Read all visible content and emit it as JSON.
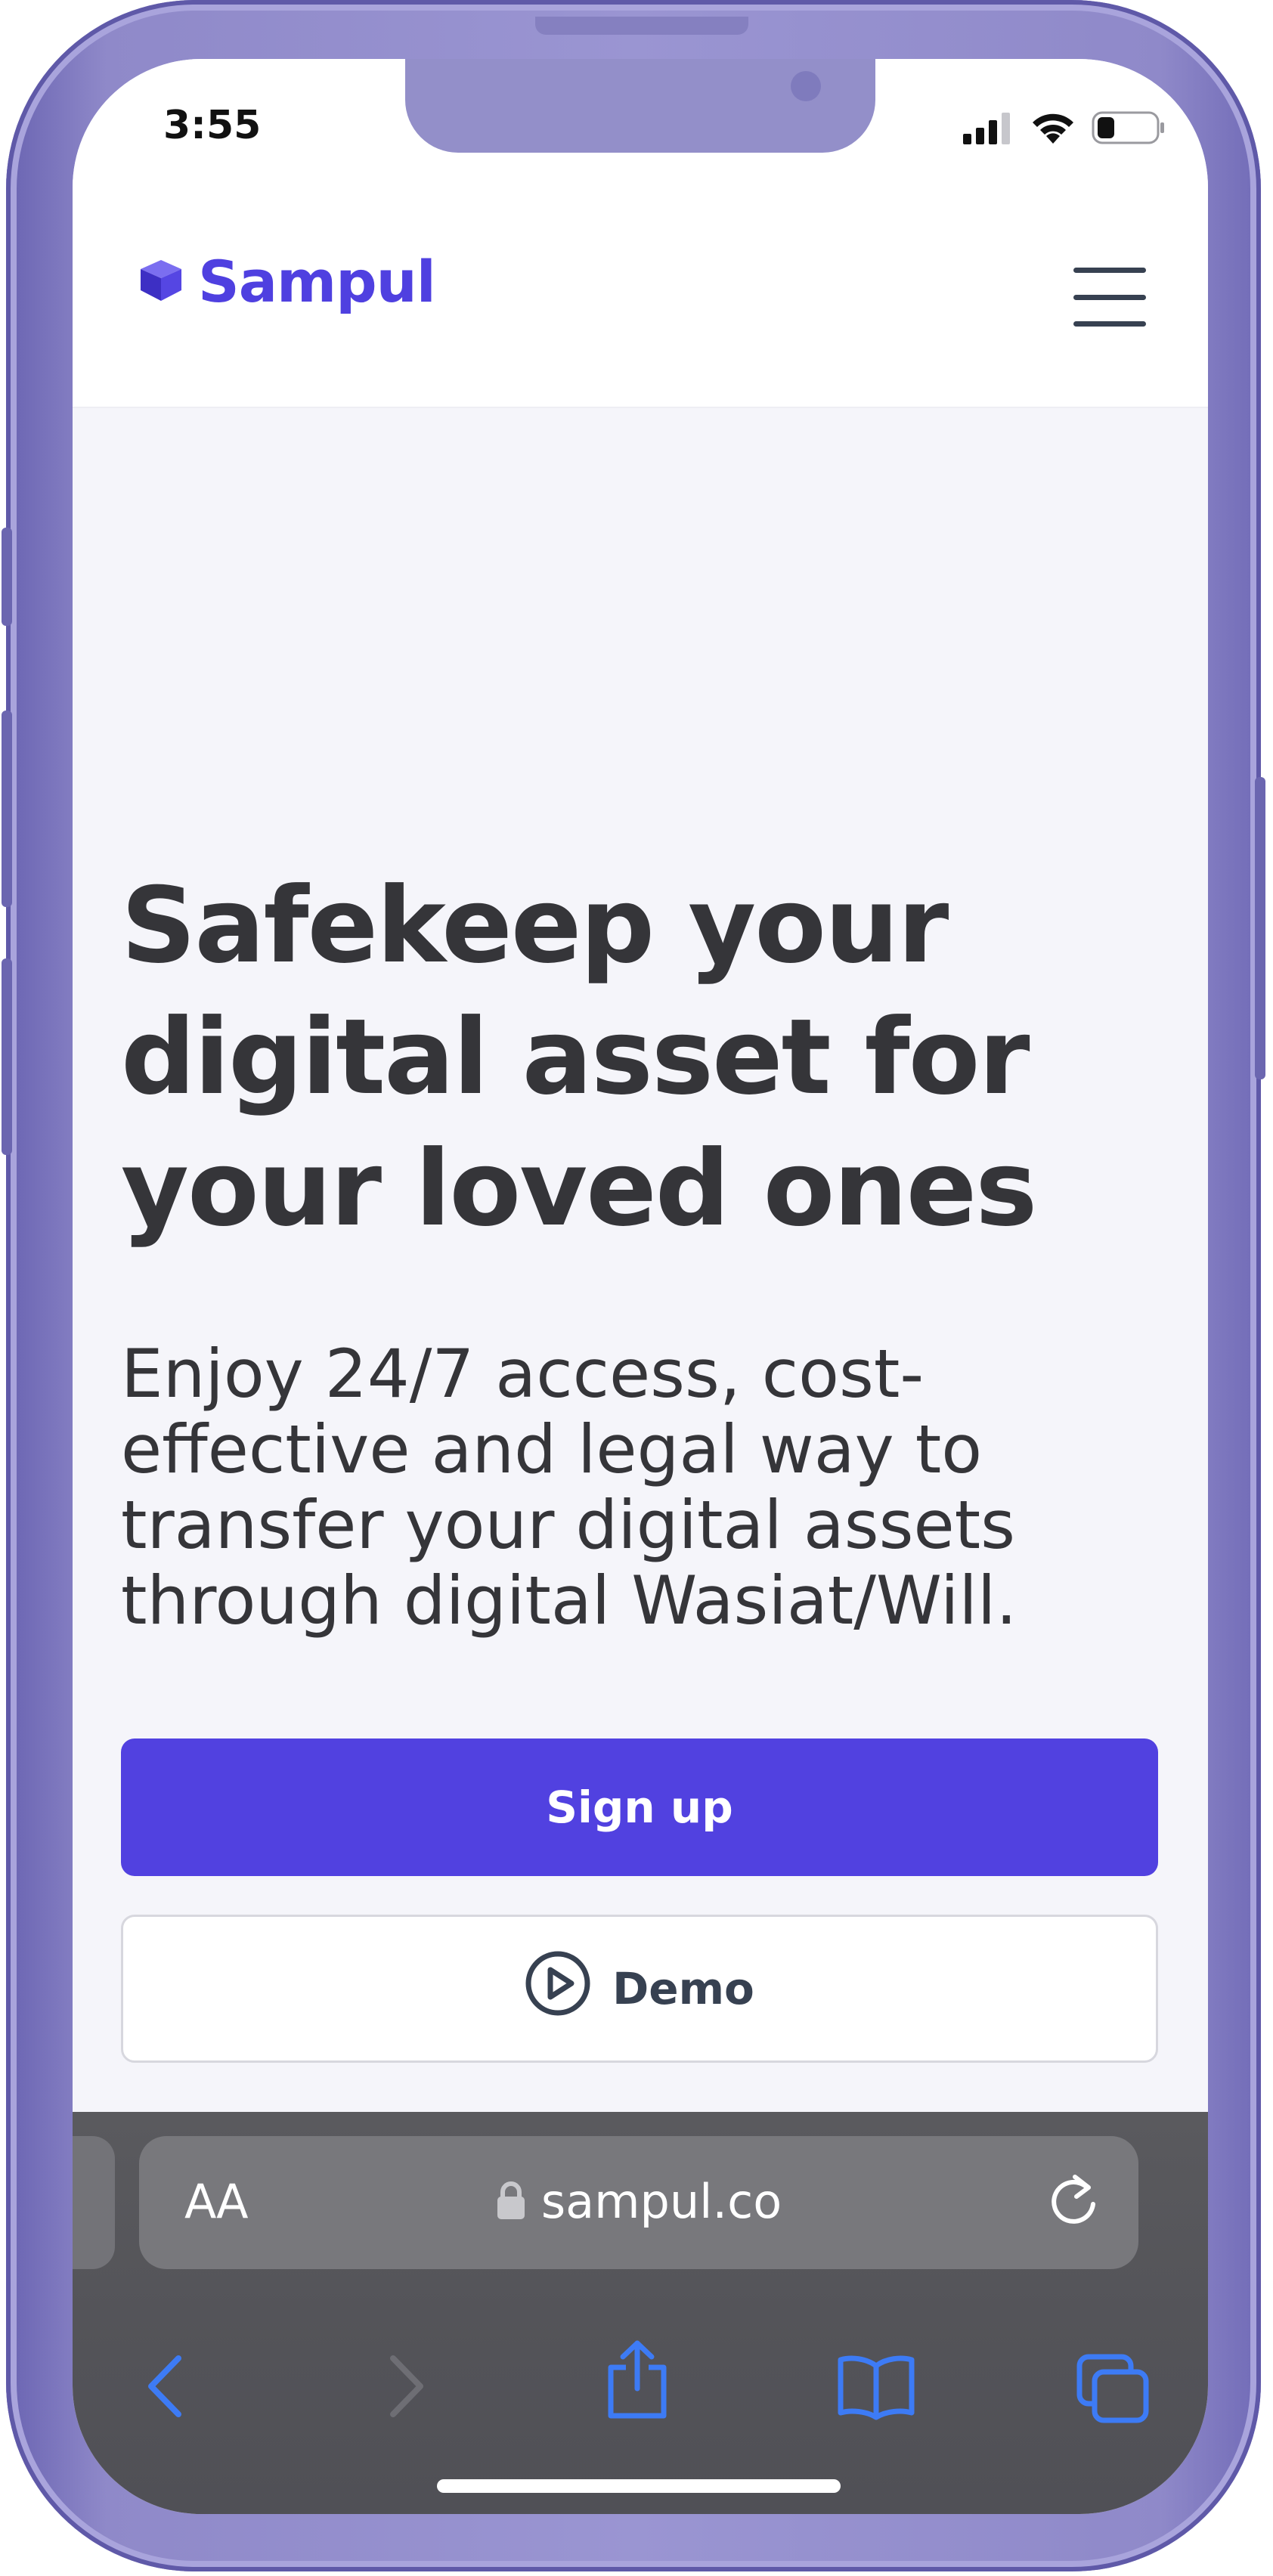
{
  "status_bar": {
    "time": "3:55",
    "icons": [
      "cellular-signal-icon",
      "wifi-icon",
      "battery-icon"
    ]
  },
  "header": {
    "brand_name": "Sampul",
    "brand_color": "#4f40e0",
    "menu_icon": "hamburger-menu-icon"
  },
  "hero": {
    "title_lines": [
      "Safekeep your",
      "digital asset for",
      "your loved ones"
    ],
    "subtitle_lines": [
      "Enjoy 24/7 access, cost-",
      "effective and legal way to",
      "transfer your digital assets",
      "through digital Wasiat/Will."
    ],
    "signup_label": "Sign up",
    "demo_label": "Demo",
    "demo_icon": "play-circle-icon",
    "primary_color": "#5141e0"
  },
  "browser": {
    "text_size_label": "AA",
    "url": "sampul.co",
    "lock_icon": "lock-icon",
    "reload_icon": "reload-icon",
    "nav_icons": [
      "back-icon",
      "forward-icon",
      "share-icon",
      "bookmarks-icon",
      "tabs-icon"
    ]
  }
}
